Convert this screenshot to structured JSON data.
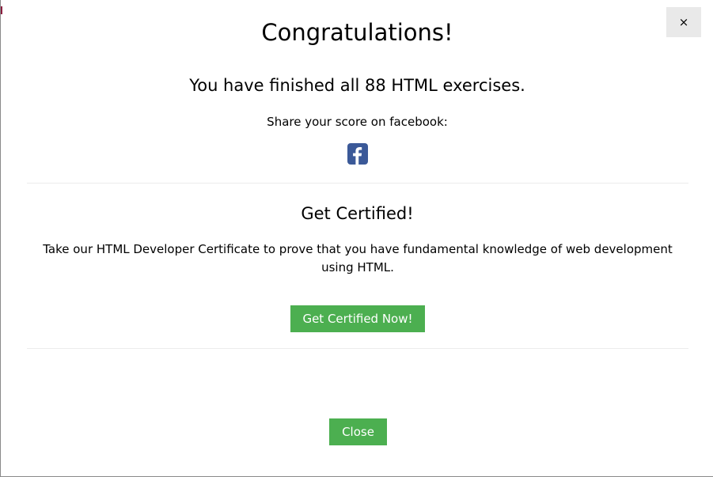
{
  "dialog": {
    "close_x_label": "×",
    "title": "Congratulations!",
    "finished_text": "You have finished all 88 HTML exercises.",
    "share_text": "Share your score on facebook:",
    "facebook_icon": "facebook-square-icon",
    "facebook_color": "#3b5998"
  },
  "certificate": {
    "title": "Get Certified!",
    "description": "Take our HTML Developer Certificate to prove that you have fundamental knowledge of web development using HTML.",
    "button_label": "Get Certified Now!"
  },
  "footer": {
    "close_label": "Close"
  },
  "colors": {
    "accent_green": "#4caf50",
    "close_x_bg": "#e9e9e9",
    "divider": "#ececec"
  }
}
